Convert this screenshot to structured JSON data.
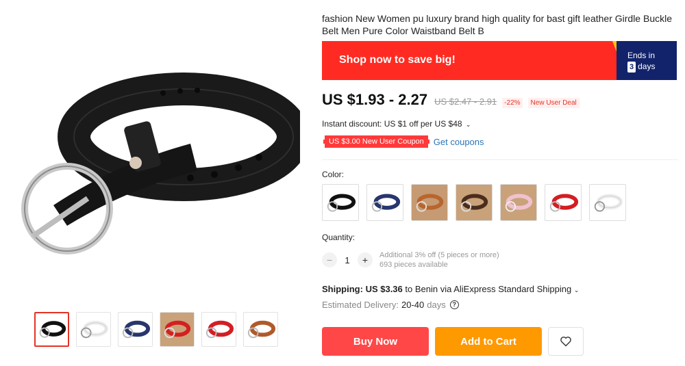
{
  "product": {
    "title": "fashion New Women pu luxury brand high quality for bast gift leather Girdle Buckle Belt Men Pure Color Waistband Belt B"
  },
  "promo": {
    "text": "Shop now to save big!",
    "ends_label": "Ends in",
    "days_count": "3",
    "days_label": "days",
    "bg_color": "#ff2b22",
    "accent_color": "#12236b"
  },
  "price": {
    "current": "US $1.93 - 2.27",
    "original": "US $2.47 - 2.91",
    "discount": "-22%",
    "badge": "New User Deal"
  },
  "discount": {
    "instant": "Instant discount: US $1 off per US $48",
    "coupon": "US $3.00 New User Coupon",
    "get_coupons": "Get coupons"
  },
  "color": {
    "label": "Color:",
    "options": [
      "black",
      "navy",
      "brown",
      "dark-brown",
      "pink",
      "red",
      "white"
    ]
  },
  "quantity": {
    "label": "Quantity:",
    "value": "1",
    "minus": "−",
    "plus": "+",
    "note": "Additional 3% off (5 pieces or more)",
    "available": "693 pieces available"
  },
  "shipping": {
    "label": "Shipping:",
    "price": "US $3.36",
    "text": "to Benin via AliExpress Standard Shipping",
    "delivery_label": "Estimated Delivery:",
    "delivery_value": "20-40",
    "delivery_unit": "days"
  },
  "actions": {
    "buy_now": "Buy Now",
    "add_to_cart": "Add to Cart"
  },
  "gallery": {
    "thumbs": [
      "black",
      "white",
      "navy",
      "red",
      "red",
      "brown"
    ],
    "selected": 0
  }
}
